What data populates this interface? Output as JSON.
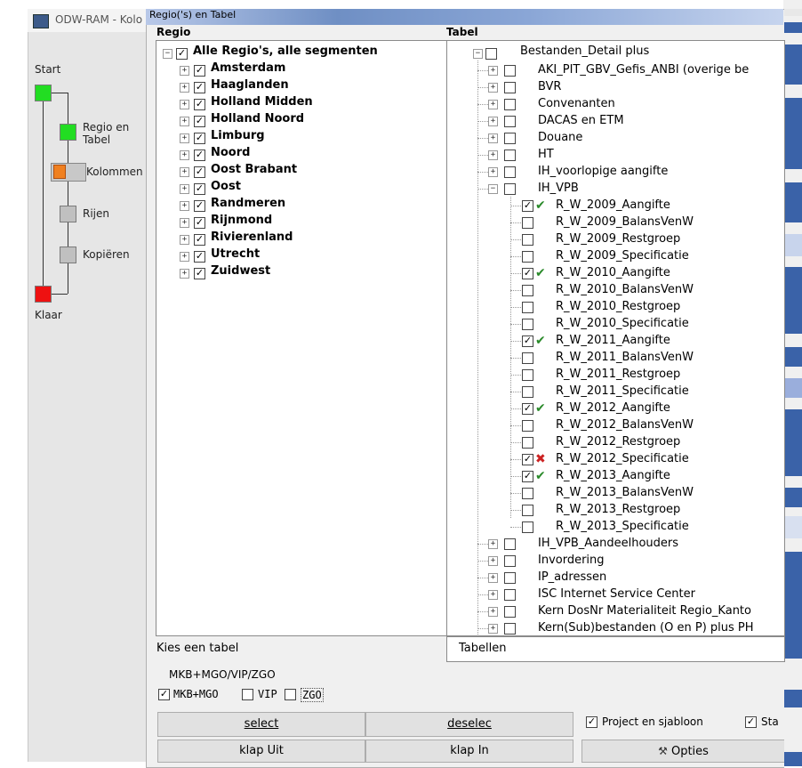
{
  "wizard": {
    "title": "ODW-RAM - Kolo",
    "steps": [
      {
        "label": "Start",
        "color": "#22dd22"
      },
      {
        "label": "Regio en\nTabel",
        "color": "#22dd22"
      },
      {
        "label": "Kolommen",
        "color": "#f08020"
      },
      {
        "label": "Rijen",
        "color": "#c0c0c0"
      },
      {
        "label": "Kopiëren",
        "color": "#c0c0c0"
      },
      {
        "label": "Klaar",
        "color": "#ee1111"
      }
    ]
  },
  "dialog": {
    "title": "Regio('s) en Tabel",
    "regio_header": "Regio",
    "tabel_header": "Tabel",
    "regio_root": "Alle Regio's, alle segmenten",
    "regios": [
      "Amsterdam",
      "Haaglanden",
      "Holland Midden",
      "Holland Noord",
      "Limburg",
      "Noord",
      "Oost Brabant",
      "Oost",
      "Randmeren",
      "Rijnmond",
      "Rivierenland",
      "Utrecht",
      "Zuidwest"
    ],
    "tabel_root": "Bestanden_Detail plus",
    "tabel_items": [
      {
        "label": "AKI_PIT_GBV_Gefis_ANBI (overige be",
        "level": 1,
        "expand": "+",
        "checked": false,
        "status": ""
      },
      {
        "label": "BVR",
        "level": 1,
        "expand": "+",
        "checked": false,
        "status": ""
      },
      {
        "label": "Convenanten",
        "level": 1,
        "expand": "+",
        "checked": false,
        "status": ""
      },
      {
        "label": "DACAS en ETM",
        "level": 1,
        "expand": "+",
        "checked": false,
        "status": ""
      },
      {
        "label": "Douane",
        "level": 1,
        "expand": "+",
        "checked": false,
        "status": ""
      },
      {
        "label": "HT",
        "level": 1,
        "expand": "+",
        "checked": false,
        "status": ""
      },
      {
        "label": "IH_voorlopige aangifte",
        "level": 1,
        "expand": "+",
        "checked": false,
        "status": ""
      },
      {
        "label": "IH_VPB",
        "level": 1,
        "expand": "-",
        "checked": false,
        "status": ""
      },
      {
        "label": "R_W_2009_Aangifte",
        "level": 2,
        "expand": "",
        "checked": true,
        "status": "ok"
      },
      {
        "label": "R_W_2009_BalansVenW",
        "level": 2,
        "expand": "",
        "checked": false,
        "status": ""
      },
      {
        "label": "R_W_2009_Restgroep",
        "level": 2,
        "expand": "",
        "checked": false,
        "status": ""
      },
      {
        "label": "R_W_2009_Specificatie",
        "level": 2,
        "expand": "",
        "checked": false,
        "status": ""
      },
      {
        "label": "R_W_2010_Aangifte",
        "level": 2,
        "expand": "",
        "checked": true,
        "status": "ok"
      },
      {
        "label": "R_W_2010_BalansVenW",
        "level": 2,
        "expand": "",
        "checked": false,
        "status": ""
      },
      {
        "label": "R_W_2010_Restgroep",
        "level": 2,
        "expand": "",
        "checked": false,
        "status": ""
      },
      {
        "label": "R_W_2010_Specificatie",
        "level": 2,
        "expand": "",
        "checked": false,
        "status": ""
      },
      {
        "label": "R_W_2011_Aangifte",
        "level": 2,
        "expand": "",
        "checked": true,
        "status": "ok"
      },
      {
        "label": "R_W_2011_BalansVenW",
        "level": 2,
        "expand": "",
        "checked": false,
        "status": ""
      },
      {
        "label": "R_W_2011_Restgroep",
        "level": 2,
        "expand": "",
        "checked": false,
        "status": ""
      },
      {
        "label": "R_W_2011_Specificatie",
        "level": 2,
        "expand": "",
        "checked": false,
        "status": ""
      },
      {
        "label": "R_W_2012_Aangifte",
        "level": 2,
        "expand": "",
        "checked": true,
        "status": "ok"
      },
      {
        "label": "R_W_2012_BalansVenW",
        "level": 2,
        "expand": "",
        "checked": false,
        "status": ""
      },
      {
        "label": "R_W_2012_Restgroep",
        "level": 2,
        "expand": "",
        "checked": false,
        "status": ""
      },
      {
        "label": "R_W_2012_Specificatie",
        "level": 2,
        "expand": "",
        "checked": true,
        "status": "error"
      },
      {
        "label": "R_W_2013_Aangifte",
        "level": 2,
        "expand": "",
        "checked": true,
        "status": "ok"
      },
      {
        "label": "R_W_2013_BalansVenW",
        "level": 2,
        "expand": "",
        "checked": false,
        "status": ""
      },
      {
        "label": "R_W_2013_Restgroep",
        "level": 2,
        "expand": "",
        "checked": false,
        "status": ""
      },
      {
        "label": "R_W_2013_Specificatie",
        "level": 2,
        "expand": "",
        "checked": false,
        "status": ""
      },
      {
        "label": "IH_VPB_Aandeelhouders",
        "level": 1,
        "expand": "+",
        "checked": false,
        "status": ""
      },
      {
        "label": "Invordering",
        "level": 1,
        "expand": "+",
        "checked": false,
        "status": ""
      },
      {
        "label": "IP_adressen",
        "level": 1,
        "expand": "+",
        "checked": false,
        "status": ""
      },
      {
        "label": "ISC Internet Service Center",
        "level": 1,
        "expand": "+",
        "checked": false,
        "status": ""
      },
      {
        "label": "Kern DosNr Materialiteit Regio_Kanto",
        "level": 1,
        "expand": "+",
        "checked": false,
        "status": ""
      },
      {
        "label": "Kern(Sub)bestanden (O en P) plus PH",
        "level": 1,
        "expand": "+",
        "checked": false,
        "status": ""
      }
    ],
    "kies_tabel": "Kies een tabel",
    "tabellen_value": "Tabellen",
    "segment_group": "MKB+MGO/VIP/ZGO",
    "seg_mkb": "MKB+MGO",
    "seg_vip": "VIP",
    "seg_zgo": "ZGO",
    "select_btn": "select",
    "deselect_btn": "deselec",
    "klap_uit_btn": "klap Uit",
    "klap_in_btn": "klap In",
    "project_sjabloon": "Project en sjabloon",
    "sta_label": "Sta",
    "opties_btn": "Opties"
  },
  "colors": {
    "ok": "#2a8a2a",
    "error": "#cc2222",
    "accent": "#3a62a8"
  }
}
